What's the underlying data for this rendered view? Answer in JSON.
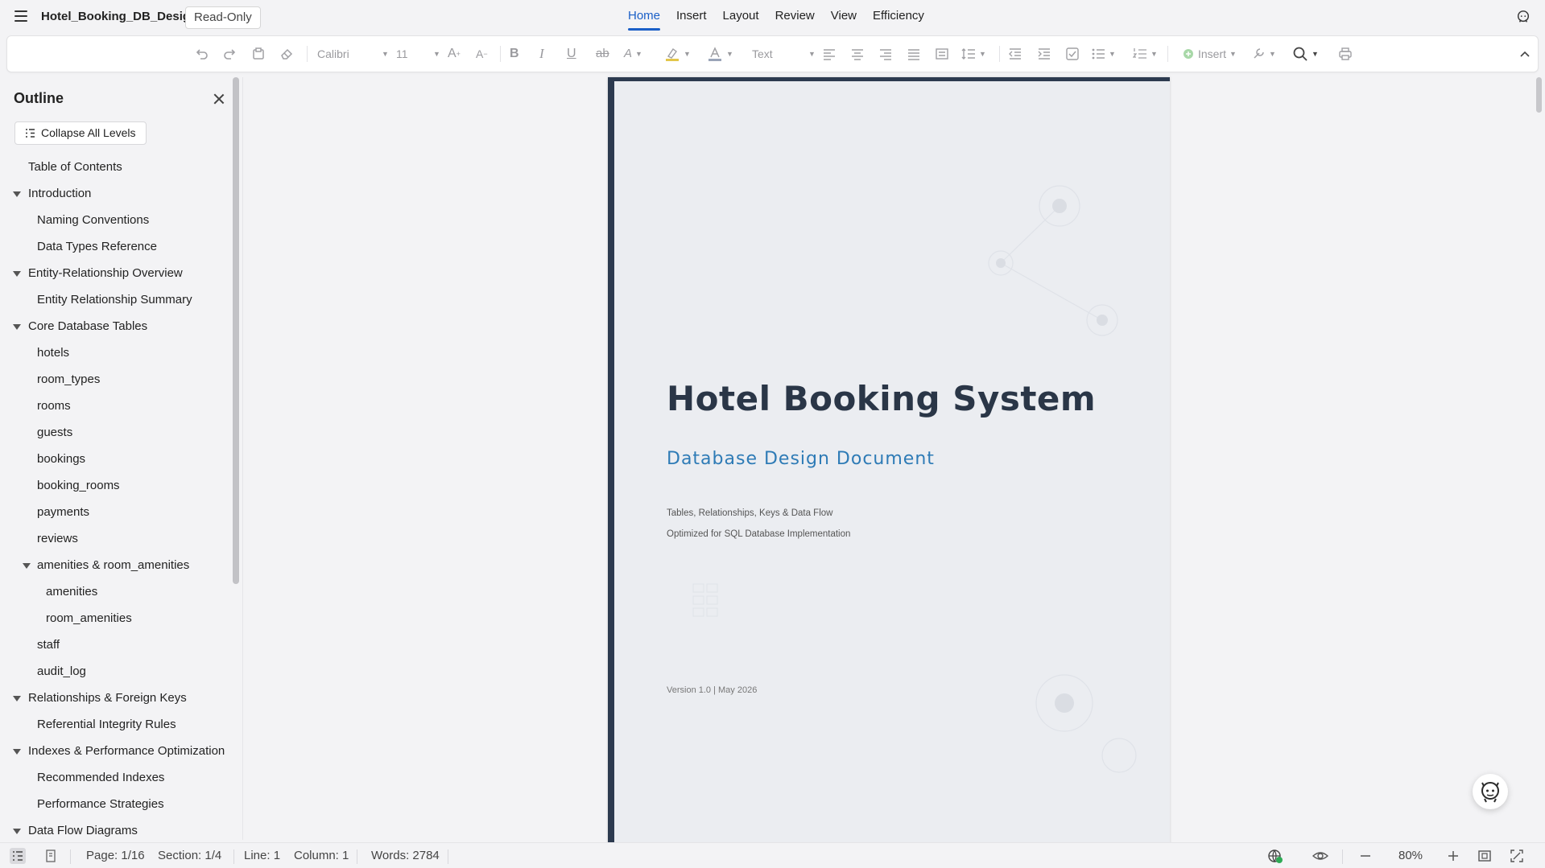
{
  "app": {
    "doc_title": "Hotel_Booking_DB_Design",
    "mode_badge": "Read-Only"
  },
  "nav": {
    "tabs": [
      "Home",
      "Insert",
      "Layout",
      "Review",
      "View",
      "Efficiency"
    ],
    "active": "Home"
  },
  "toolbar": {
    "font_name": "Calibri",
    "font_size": "11",
    "style_name": "Text",
    "insert_label": "Insert",
    "icons": [
      "undo-icon",
      "redo-icon",
      "format-painter-icon",
      "eraser-icon",
      "grow-font-icon",
      "shrink-font-icon",
      "bold-icon",
      "italic-icon",
      "underline-icon",
      "strikethrough-icon",
      "text-effect-icon",
      "highlight-icon",
      "font-color-icon",
      "align-left-icon",
      "align-center-icon",
      "align-right-icon",
      "justify-icon",
      "distributed-icon",
      "line-spacing-icon",
      "decrease-indent-icon",
      "increase-indent-icon",
      "checkbox-icon",
      "bullets-icon",
      "numbering-icon",
      "insert-icon",
      "tools-icon",
      "search-icon",
      "print-icon",
      "collapse-toolbar-icon"
    ]
  },
  "sidebar": {
    "title": "Outline",
    "collapse_label": "Collapse All Levels",
    "items": [
      {
        "label": "Table of Contents",
        "level": 1,
        "expandable": false
      },
      {
        "label": "Introduction",
        "level": 1,
        "expandable": true
      },
      {
        "label": "Naming Conventions",
        "level": 2,
        "expandable": false
      },
      {
        "label": "Data Types Reference",
        "level": 2,
        "expandable": false
      },
      {
        "label": "Entity-Relationship Overview",
        "level": 1,
        "expandable": true
      },
      {
        "label": "Entity Relationship Summary",
        "level": 2,
        "expandable": false
      },
      {
        "label": "Core Database Tables",
        "level": 1,
        "expandable": true
      },
      {
        "label": "hotels",
        "level": 2,
        "expandable": false
      },
      {
        "label": "room_types",
        "level": 2,
        "expandable": false
      },
      {
        "label": "rooms",
        "level": 2,
        "expandable": false
      },
      {
        "label": "guests",
        "level": 2,
        "expandable": false
      },
      {
        "label": "bookings",
        "level": 2,
        "expandable": false
      },
      {
        "label": "booking_rooms",
        "level": 2,
        "expandable": false
      },
      {
        "label": "payments",
        "level": 2,
        "expandable": false
      },
      {
        "label": "reviews",
        "level": 2,
        "expandable": false
      },
      {
        "label": "amenities & room_amenities",
        "level": 2,
        "expandable": true
      },
      {
        "label": "amenities",
        "level": 3,
        "expandable": false
      },
      {
        "label": "room_amenities",
        "level": 3,
        "expandable": false
      },
      {
        "label": "staff",
        "level": 2,
        "expandable": false
      },
      {
        "label": "audit_log",
        "level": 2,
        "expandable": false
      },
      {
        "label": "Relationships & Foreign Keys",
        "level": 1,
        "expandable": true
      },
      {
        "label": "Referential Integrity Rules",
        "level": 2,
        "expandable": false
      },
      {
        "label": "Indexes & Performance Optimization",
        "level": 1,
        "expandable": true
      },
      {
        "label": "Recommended Indexes",
        "level": 2,
        "expandable": false
      },
      {
        "label": "Performance Strategies",
        "level": 2,
        "expandable": false
      },
      {
        "label": "Data Flow Diagrams",
        "level": 1,
        "expandable": true
      }
    ]
  },
  "document": {
    "title": "Hotel Booking System",
    "subtitle": "Database Design Document",
    "line1": "Tables, Relationships, Keys & Data Flow",
    "line2": "Optimized for SQL Database Implementation",
    "version_line": "Version 1.0  |  May 2026"
  },
  "status": {
    "page": "Page: 1/16",
    "section": "Section: 1/4",
    "line": "Line: 1",
    "column": "Column: 1",
    "words": "Words: 2784",
    "zoom": "80%"
  },
  "colors": {
    "accent": "#1a5fc7",
    "doc_title": "#2a3647",
    "doc_subtitle": "#2e7bb6",
    "page_border": "#2c3a4f"
  }
}
